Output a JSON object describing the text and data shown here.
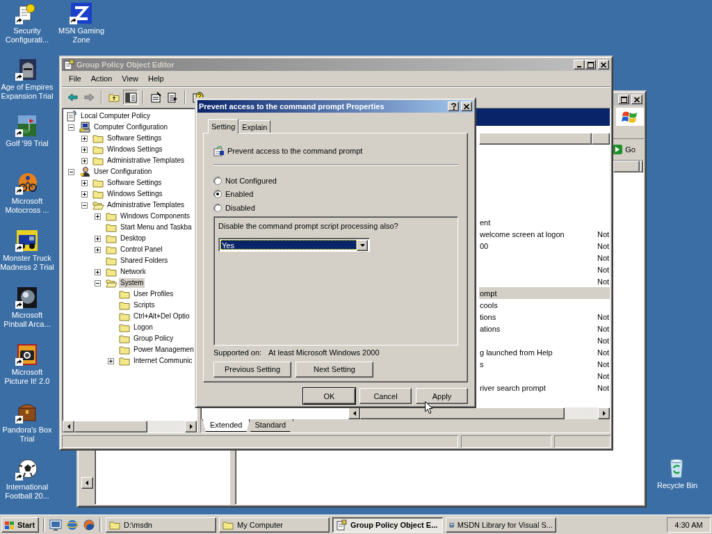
{
  "desktop": {
    "icons": [
      {
        "label": "Security Configurati..."
      },
      {
        "label": "MSN Gaming Zone"
      },
      {
        "label": "Age of Empires Expansion Trial"
      },
      {
        "label": "Golf '99 Trial"
      },
      {
        "label": "Microsoft Motocross ..."
      },
      {
        "label": "Monster Truck Madness 2 Trial"
      },
      {
        "label": "Microsoft Pinball Arca..."
      },
      {
        "label": "Microsoft Picture It! 2.0"
      },
      {
        "label": "Pandora's Box Trial"
      },
      {
        "label": "International Football 20..."
      },
      {
        "label": "Recycle Bin"
      }
    ]
  },
  "background_window": {
    "go_button": "Go"
  },
  "gpo_window": {
    "title": "Group Policy Object Editor",
    "menu": [
      "File",
      "Action",
      "View",
      "Help"
    ],
    "tree": [
      {
        "label": "Local Computer Policy",
        "kind": "policy",
        "selected": false,
        "children": [
          {
            "label": "Computer Configuration",
            "kind": "computer",
            "expanded": true,
            "selected": false,
            "children": [
              {
                "label": "Software Settings",
                "kind": "folder",
                "expanded": false,
                "selected": false
              },
              {
                "label": "Windows Settings",
                "kind": "folder",
                "expanded": false,
                "selected": false
              },
              {
                "label": "Administrative Templates",
                "kind": "folder",
                "expanded": false,
                "selected": false
              }
            ]
          },
          {
            "label": "User Configuration",
            "kind": "user",
            "expanded": true,
            "selected": false,
            "children": [
              {
                "label": "Software Settings",
                "kind": "folder",
                "expanded": false,
                "selected": false
              },
              {
                "label": "Windows Settings",
                "kind": "folder",
                "expanded": false,
                "selected": false
              },
              {
                "label": "Administrative Templates",
                "kind": "folder",
                "expanded": true,
                "selected": false,
                "children": [
                  {
                    "label": "Windows Components",
                    "kind": "folder",
                    "expanded": false,
                    "selected": false
                  },
                  {
                    "label": "Start Menu and Taskba",
                    "kind": "folder",
                    "selected": false
                  },
                  {
                    "label": "Desktop",
                    "kind": "folder",
                    "expanded": false,
                    "selected": false
                  },
                  {
                    "label": "Control Panel",
                    "kind": "folder",
                    "expanded": false,
                    "selected": false
                  },
                  {
                    "label": "Shared Folders",
                    "kind": "folder",
                    "selected": false
                  },
                  {
                    "label": "Network",
                    "kind": "folder",
                    "expanded": false,
                    "selected": false
                  },
                  {
                    "label": "System",
                    "kind": "folder",
                    "expanded": true,
                    "selected": true,
                    "children": [
                      {
                        "label": "User Profiles",
                        "kind": "folder",
                        "selected": false
                      },
                      {
                        "label": "Scripts",
                        "kind": "folder",
                        "selected": false
                      },
                      {
                        "label": "Ctrl+Alt+Del Optio",
                        "kind": "folder",
                        "selected": false
                      },
                      {
                        "label": "Logon",
                        "kind": "folder",
                        "selected": false
                      },
                      {
                        "label": "Group Policy",
                        "kind": "folder",
                        "selected": false
                      },
                      {
                        "label": "Power Managemen",
                        "kind": "folder",
                        "selected": false
                      },
                      {
                        "label": "Internet Communic",
                        "kind": "folder",
                        "expanded": false,
                        "selected": false
                      }
                    ]
                  }
                ]
              }
            ]
          }
        ]
      }
    ],
    "list_rows": [
      {
        "name": "ent",
        "selected": false
      },
      {
        "name": "welcome screen at logon",
        "state": "Not",
        "selected": false
      },
      {
        "name": "00",
        "state": "Not",
        "selected": false
      },
      {
        "state": "Not",
        "selected": false
      },
      {
        "state": "Not",
        "selected": false
      },
      {
        "state": "Not",
        "selected": false
      },
      {
        "name": "ompt",
        "selected": true
      },
      {
        "name": "cools",
        "selected": false
      },
      {
        "name": "tions",
        "state": "Not",
        "selected": false
      },
      {
        "name": "ations",
        "state": "Not",
        "selected": false
      },
      {
        "state": "Not",
        "selected": false
      },
      {
        "name": "g launched from Help",
        "state": "Not",
        "selected": false
      },
      {
        "name": "s",
        "state": "Not",
        "selected": false
      },
      {
        "state": "Not",
        "selected": false
      },
      {
        "name": "river search prompt",
        "state": "Not",
        "selected": false
      }
    ],
    "view_tabs": [
      {
        "label": "Extended",
        "selected": true
      },
      {
        "label": "Standard",
        "selected": false
      }
    ]
  },
  "dialog": {
    "title": "Prevent access to the command prompt Properties",
    "tabs": [
      {
        "label": "Setting",
        "selected": true
      },
      {
        "label": "Explain",
        "selected": false
      }
    ],
    "policy_name": "Prevent access to the command prompt",
    "options": [
      {
        "label": "Not Configured",
        "selected": false
      },
      {
        "label": "Enabled",
        "selected": true
      },
      {
        "label": "Disabled",
        "selected": false
      }
    ],
    "option_prompt": "Disable the command prompt script processing also?",
    "dropdown": {
      "value": "Yes"
    },
    "supported_label": "Supported on:",
    "supported_value": "At least Microsoft Windows 2000",
    "nav_buttons": [
      "Previous Setting",
      "Next Setting"
    ],
    "buttons": [
      {
        "label": "OK",
        "default": true
      },
      {
        "label": "Cancel",
        "default": false
      },
      {
        "label": "Apply",
        "default": false
      }
    ]
  },
  "taskbar": {
    "start": "Start",
    "tasks": [
      {
        "label": "D:\\msdn",
        "selected": false
      },
      {
        "label": "My Computer",
        "selected": false
      },
      {
        "label": "Group Policy Object E...",
        "selected": true
      },
      {
        "label": "MSDN Library for Visual S...",
        "selected": false
      }
    ],
    "clock": "4:30 AM"
  }
}
